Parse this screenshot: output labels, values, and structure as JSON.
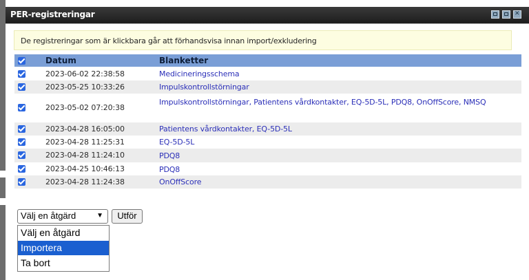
{
  "window": {
    "title": "PER-registreringar",
    "controls": [
      "minimize-icon",
      "restore-icon",
      "close-icon"
    ]
  },
  "info_message": "De registreringar som är klickbara går att förhandsvisa innan import/exkludering",
  "table": {
    "header": {
      "checked": true,
      "date_label": "Datum",
      "forms_label": "Blanketter"
    },
    "rows": [
      {
        "checked": true,
        "date": "2023-06-02 22:38:58",
        "forms": "Medicineringsschema"
      },
      {
        "checked": true,
        "date": "2023-05-25 10:33:26",
        "forms": "Impulskontrollstörningar"
      },
      {
        "checked": true,
        "date": "2023-05-02 07:20:38",
        "forms": "Impulskontrollstörningar, Patientens vårdkontakter, EQ-5D-5L, PDQ8, OnOffScore, NMSQ"
      },
      {
        "checked": true,
        "date": "2023-04-28 16:05:00",
        "forms": "Patientens vårdkontakter, EQ-5D-5L"
      },
      {
        "checked": true,
        "date": "2023-04-28 11:25:31",
        "forms": "EQ-5D-5L"
      },
      {
        "checked": true,
        "date": "2023-04-28 11:24:10",
        "forms": "PDQ8"
      },
      {
        "checked": true,
        "date": "2023-04-25 10:46:13",
        "forms": "PDQ8"
      },
      {
        "checked": true,
        "date": "2023-04-28 11:24:38",
        "forms": "OnOffScore"
      }
    ]
  },
  "action": {
    "selected": "Välj en åtgärd",
    "button_label": "Utför",
    "options": [
      "Välj en åtgärd",
      "Importera",
      "Ta bort"
    ],
    "highlighted_option": "Importera"
  }
}
